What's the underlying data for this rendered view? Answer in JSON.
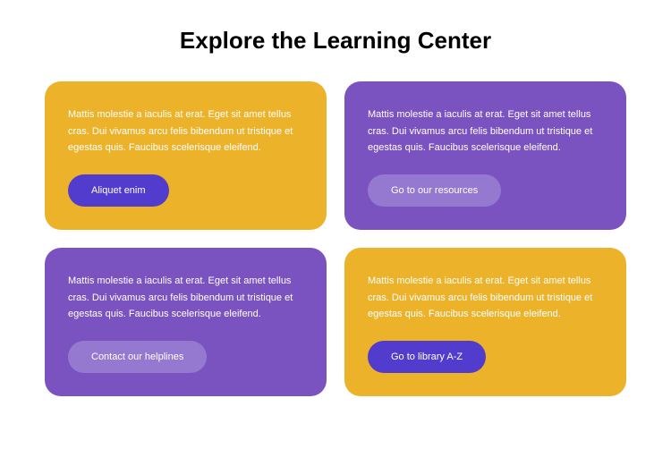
{
  "title": "Explore the Learning Center",
  "cards": {
    "c1": {
      "text": "Mattis molestie a iaculis at erat. Eget sit amet tellus cras. Dui vivamus arcu felis bibendum ut tristique et egestas quis. Faucibus scelerisque eleifend.",
      "button": "Aliquet enim"
    },
    "c2": {
      "text": "Mattis molestie a iaculis at erat. Eget sit amet tellus cras. Dui vivamus arcu felis bibendum ut tristique et egestas quis. Faucibus scelerisque eleifend.",
      "button": "Go to our resources"
    },
    "c3": {
      "text": "Mattis molestie a iaculis at erat. Eget sit amet tellus cras. Dui vivamus arcu felis bibendum ut tristique et egestas quis. Faucibus scelerisque eleifend.",
      "button": "Contact our helplines"
    },
    "c4": {
      "text": "Mattis molestie a iaculis at erat. Eget sit amet tellus cras. Dui vivamus arcu felis bibendum ut tristique et egestas quis. Faucibus scelerisque eleifend.",
      "button": "Go to library A-Z"
    }
  }
}
